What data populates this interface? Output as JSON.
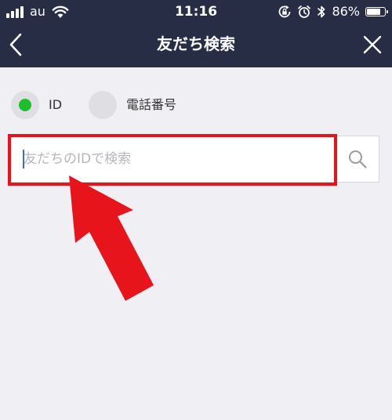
{
  "status_bar": {
    "carrier": "au",
    "time": "11:16",
    "battery_percent": "86%",
    "battery_level": 0.86,
    "icons": [
      "signal-icon",
      "wifi-icon",
      "rotation-lock-icon",
      "alarm-icon",
      "bluetooth-icon",
      "battery-icon"
    ]
  },
  "nav": {
    "title": "友だち検索",
    "back_icon": "chevron-left-icon",
    "close_icon": "close-icon"
  },
  "search_type": {
    "options": [
      {
        "label": "ID",
        "selected": true
      },
      {
        "label": "電話番号",
        "selected": false
      }
    ],
    "selected_color": "#1fbf2a"
  },
  "search": {
    "placeholder": "友だちのIDで検索",
    "value": "",
    "icon": "search-icon"
  },
  "annotation": {
    "highlight_color": "#e8141c",
    "arrow_icon": "arrow-icon"
  },
  "colors": {
    "header_bg": "#262d45",
    "page_bg": "#f0f0f4"
  }
}
